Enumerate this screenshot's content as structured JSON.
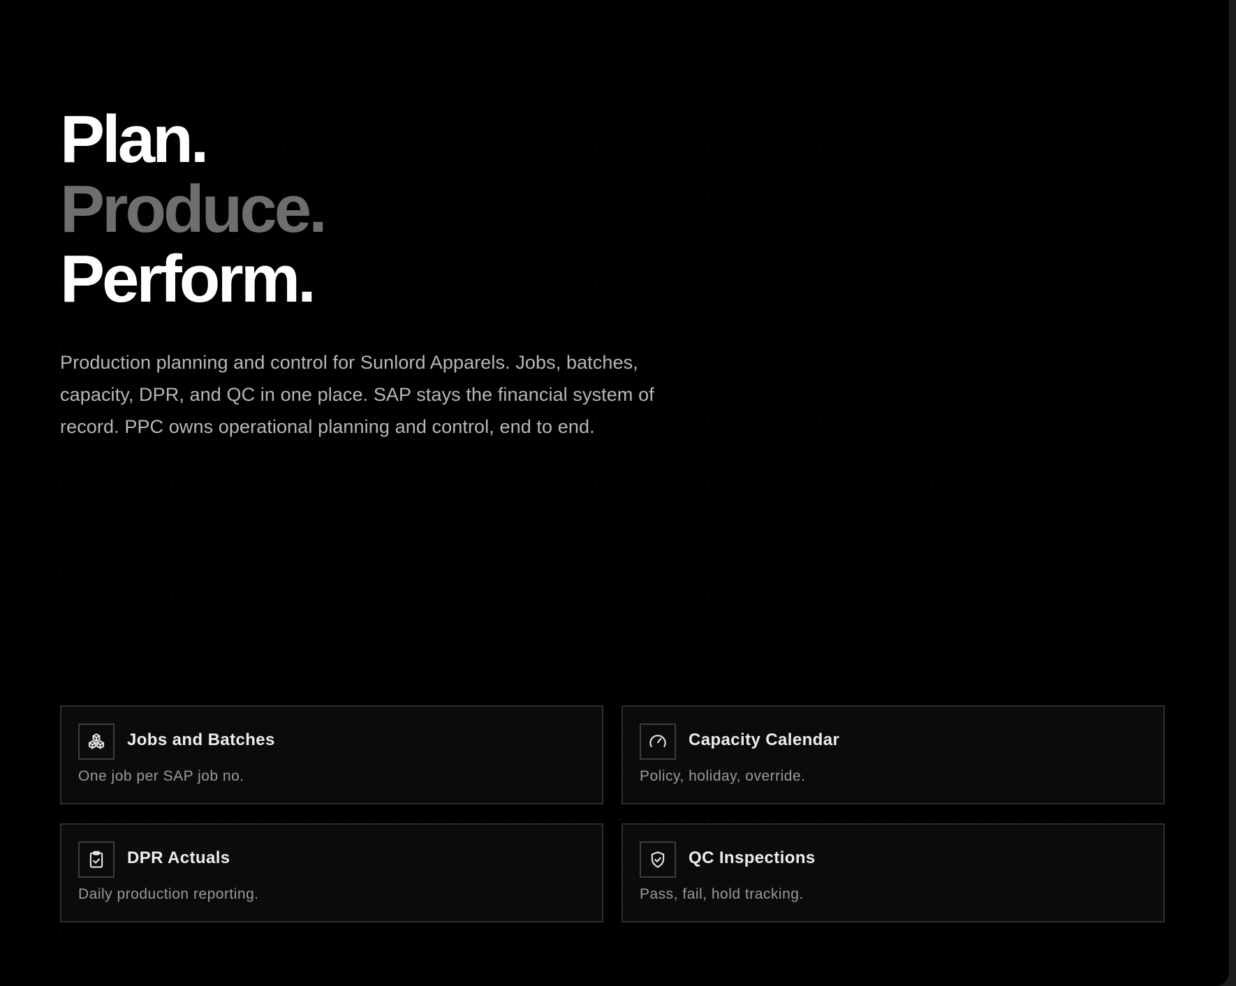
{
  "hero": {
    "line1": "Plan.",
    "line2": "Produce.",
    "line3": "Perform.",
    "description": "Production planning and control for Sunlord Apparels. Jobs, batches, capacity, DPR, and QC in one place. SAP stays the financial system of record. PPC owns operational planning and control, end to end."
  },
  "features": [
    {
      "title": "Jobs and Batches",
      "description": "One job per SAP job no.",
      "icon": "boxes-icon"
    },
    {
      "title": "Capacity Calendar",
      "description": "Policy, holiday, override.",
      "icon": "gauge-icon"
    },
    {
      "title": "DPR Actuals",
      "description": "Daily production reporting.",
      "icon": "clipboard-check-icon"
    },
    {
      "title": "QC Inspections",
      "description": "Pass, fail, hold tracking.",
      "icon": "shield-check-icon"
    }
  ],
  "colors": {
    "background": "#000000",
    "headline_primary": "#ffffff",
    "headline_muted": "#6e6e6e",
    "body_text": "#b8b8b8",
    "card_border": "#2e2e2e"
  }
}
